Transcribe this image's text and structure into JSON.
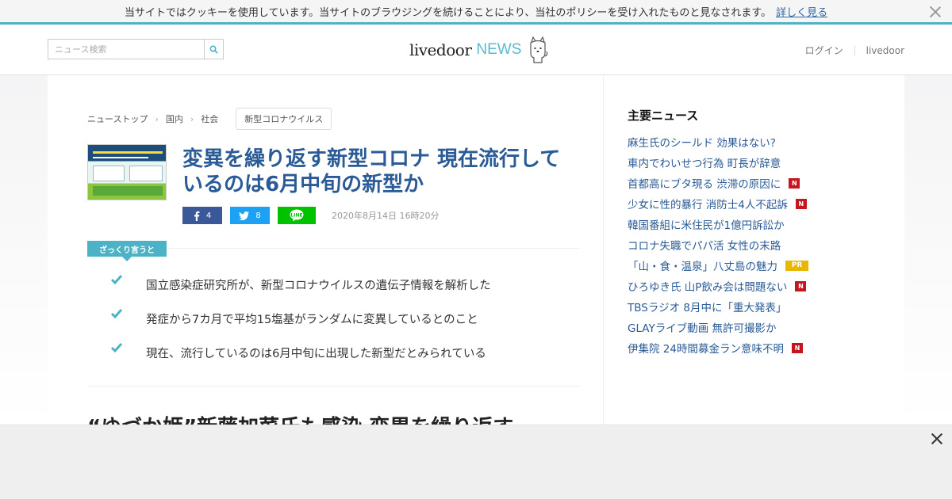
{
  "cookie": {
    "message": "当サイトではクッキーを使用しています。当サイトのブラウジングを続けることにより、当社のポリシーを受け入れたものと見なされます。",
    "more_label": "詳しく見る"
  },
  "header": {
    "search_placeholder": "ニュース検索",
    "logo_main": "livedoor",
    "logo_news": "NEWS",
    "login": "ログイン",
    "livedoor_link": "livedoor"
  },
  "breadcrumb": {
    "items": [
      "ニューストップ",
      "国内",
      "社会"
    ],
    "tag": "新型コロナウイルス"
  },
  "article": {
    "title": "変異を繰り返す新型コロナ 現在流行しているのは6月中旬の新型か",
    "fb_count": "4",
    "tw_count": "8",
    "date": "2020年8月14日 16時20分",
    "summary_label": "ざっくり言うと",
    "summary": [
      "国立感染症研究所が、新型コロナウイルスの遺伝子情報を解析した",
      "発症から7カ月で平均15塩基がランダムに変異しているとのこと",
      "現在、流行しているのは6月中旬に出現した新型だとみられている"
    ],
    "next_title": "“ゆづか姫”新藤加菜氏も感染 変異を繰り返す"
  },
  "sidebar": {
    "heading": "主要ニュース",
    "items": [
      {
        "text": "麻生氏のシールド 効果はない?",
        "badge": ""
      },
      {
        "text": "車内でわいせつ行為 町長が辞意",
        "badge": ""
      },
      {
        "text": "首都高にブタ現る 渋滞の原因に",
        "badge": "N"
      },
      {
        "text": "少女に性的暴行 消防士4人不起訴",
        "badge": "N"
      },
      {
        "text": "韓国番組に米住民が1億円訴訟か",
        "badge": ""
      },
      {
        "text": "コロナ失職でパパ活 女性の末路",
        "badge": ""
      },
      {
        "text": "「山・食・温泉」八丈島の魅力",
        "badge": "PR"
      },
      {
        "text": "ひろゆき氏 山P飲み会は問題ない",
        "badge": "N"
      },
      {
        "text": "TBSラジオ 8月中に「重大発表」",
        "badge": ""
      },
      {
        "text": "GLAYライブ動画 無許可撮影か",
        "badge": ""
      },
      {
        "text": "伊集院 24時間募金ラン意味不明",
        "badge": "N"
      }
    ]
  },
  "colors": {
    "accent": "#4cb3c6",
    "link": "#2a5b96",
    "badge_new": "#c4161c",
    "badge_pr": "#e8b800"
  }
}
